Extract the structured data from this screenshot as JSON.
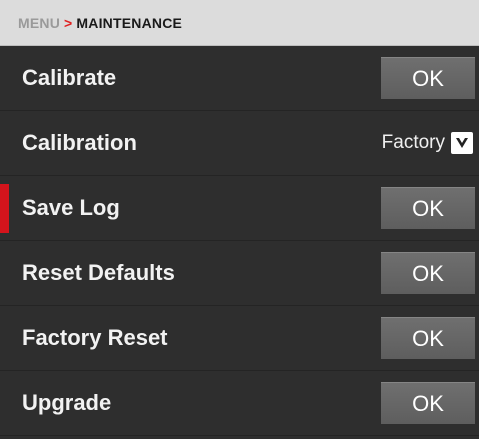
{
  "breadcrumb": {
    "root": "MENU",
    "separator": ">",
    "current": "MAINTENANCE"
  },
  "rows": [
    {
      "label": "Calibrate",
      "control": "button",
      "button_label": "OK"
    },
    {
      "label": "Calibration",
      "control": "select",
      "value": "Factory",
      "icon": "chevron-down-icon"
    },
    {
      "label": "Save Log",
      "control": "button",
      "button_label": "OK",
      "selected": true
    },
    {
      "label": "Reset Defaults",
      "control": "button",
      "button_label": "OK"
    },
    {
      "label": "Factory Reset",
      "control": "button",
      "button_label": "OK"
    },
    {
      "label": "Upgrade",
      "control": "button",
      "button_label": "OK"
    }
  ],
  "colors": {
    "accent": "#d4141c",
    "background": "#2e2e2e",
    "header": "#dcdcdc",
    "button": "#666666"
  }
}
